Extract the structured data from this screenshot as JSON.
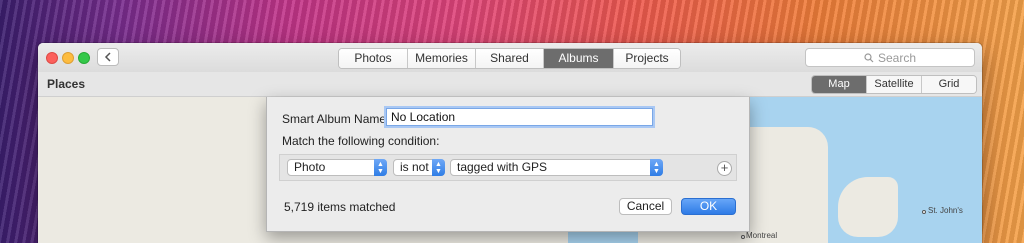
{
  "window": {
    "tabs": [
      {
        "label": "Photos"
      },
      {
        "label": "Memories"
      },
      {
        "label": "Shared"
      },
      {
        "label": "Albums",
        "active": true
      },
      {
        "label": "Projects"
      }
    ],
    "search": {
      "placeholder": "Search"
    }
  },
  "subbar": {
    "title": "Places",
    "map_types": [
      {
        "label": "Map",
        "active": true
      },
      {
        "label": "Satellite"
      },
      {
        "label": "Grid"
      }
    ]
  },
  "map": {
    "labels": {
      "st_johns": "St. John's",
      "montreal": "Montreal"
    }
  },
  "sheet": {
    "name_label": "Smart Album Name:",
    "name_value": "No Location",
    "match_label": "Match the following condition:",
    "condition": {
      "field": "Photo",
      "operator": "is not",
      "value": "tagged with GPS"
    },
    "matched_text": "5,719 items matched",
    "cancel_label": "Cancel",
    "ok_label": "OK"
  },
  "colors": {
    "accent": "#2f7de6",
    "map_water": "#a8d3ef",
    "map_land": "#eceae2"
  }
}
